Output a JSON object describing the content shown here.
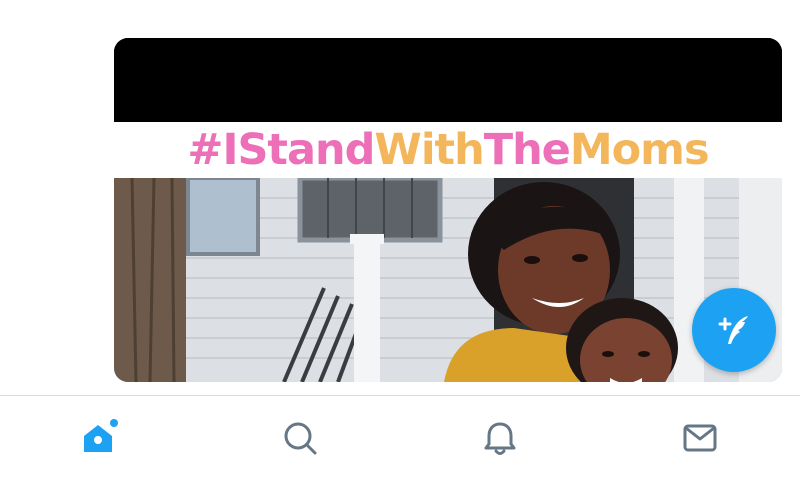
{
  "media": {
    "banner_text_parts": [
      "#IStand",
      "With",
      "The",
      "Moms"
    ]
  },
  "compose_button": {
    "icon": "compose-tweet-icon"
  },
  "colors": {
    "accent": "#1da1f2",
    "icon_gray": "#657786",
    "hashtag_pink": "#ec6fb8",
    "hashtag_gold": "#f3b65a"
  },
  "tab_bar": {
    "items": [
      {
        "name": "home",
        "icon": "home-icon",
        "active": true,
        "has_new_dot": true
      },
      {
        "name": "search",
        "icon": "search-icon",
        "active": false
      },
      {
        "name": "notifications",
        "icon": "bell-icon",
        "active": false
      },
      {
        "name": "messages",
        "icon": "mail-icon",
        "active": false
      }
    ]
  }
}
